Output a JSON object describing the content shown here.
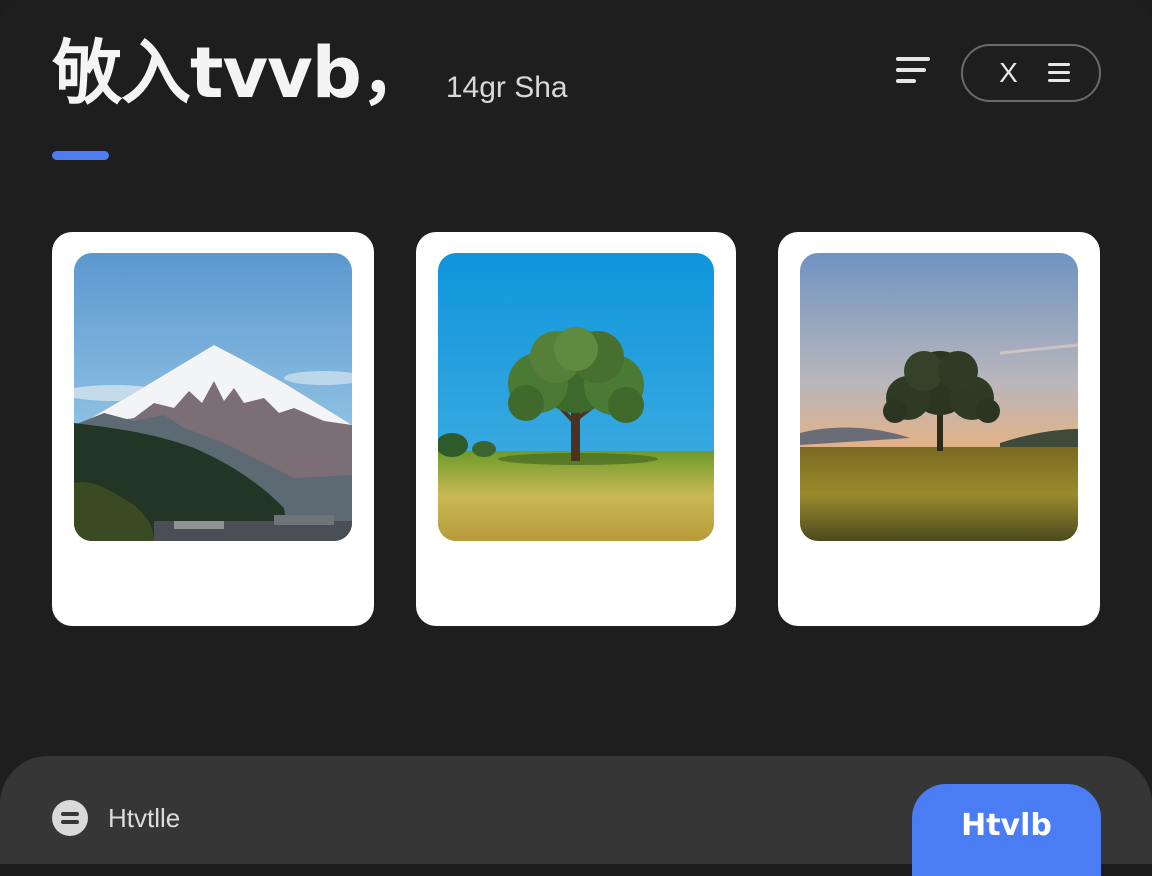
{
  "header": {
    "title": "敂入tvvb，",
    "subtitle": "14gr Sha",
    "accent_color": "#4c7cf0"
  },
  "toolbar": {
    "sort_icon": "sort-lines-icon",
    "close_label": "X",
    "menu_icon": "hamburger-menu-icon"
  },
  "gallery": {
    "cards": [
      {
        "subject": "mountain",
        "icon": "photo-mountain"
      },
      {
        "subject": "tree-midday",
        "icon": "photo-tree"
      },
      {
        "subject": "tree-sunset",
        "icon": "photo-tree-sunset"
      }
    ]
  },
  "footer": {
    "filter_icon": "filter-icon",
    "label": "Htvtlle",
    "button_label": "Htvlb",
    "button_color": "#4a7cf4"
  }
}
